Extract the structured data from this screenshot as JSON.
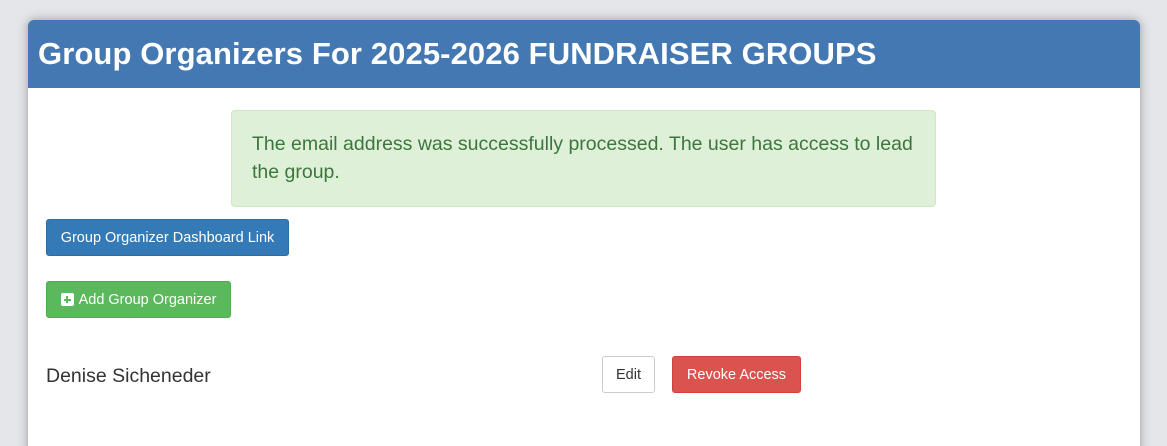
{
  "modal": {
    "title": "Group Organizers For 2025-2026 FUNDRAISER GROUPS"
  },
  "alert": {
    "message": "The email address was successfully processed. The user has access to lead the group."
  },
  "buttons": {
    "dashboard_link": "Group Organizer Dashboard Link",
    "add_organizer": "Add Group Organizer"
  },
  "organizers": [
    {
      "name": "Denise Sicheneder",
      "edit_label": "Edit",
      "revoke_label": "Revoke Access"
    }
  ],
  "colors": {
    "header": "#4478b3",
    "primary": "#337ab7",
    "success": "#5cb85c",
    "danger": "#d9534f",
    "alert_bg": "#dff0d8",
    "alert_text": "#3c763d"
  },
  "icons": {
    "add": "plus-square-icon"
  }
}
